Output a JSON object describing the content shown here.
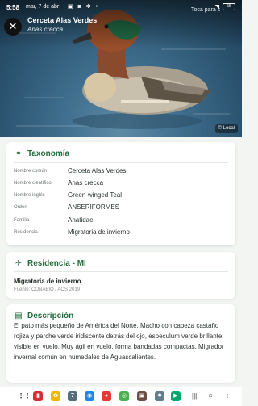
{
  "status_bar": {
    "time": "5:58",
    "date": "mar, 7 de abr",
    "icons": [
      "photo-icon",
      "camera-icon",
      "settings-icon",
      "dot-icon"
    ],
    "battery": "55"
  },
  "header": {
    "title": "Cerceta Alas Verdes",
    "subtitle": "Anas crecca",
    "tap_hint": "Toca para s",
    "photo_credit": "© Local"
  },
  "taxonomy": {
    "title": "Taxonomía",
    "rows": [
      {
        "label": "Nombre común",
        "value": "Cerceta Alas Verdes"
      },
      {
        "label": "Nombre científico",
        "value": "Anas crecca"
      },
      {
        "label": "Nombre inglés",
        "value": "Green-winged Teal"
      },
      {
        "label": "Orden",
        "value": "ANSERIFORMES"
      },
      {
        "label": "Familia",
        "value": "Anatidae"
      },
      {
        "label": "Residencia",
        "value": "Migratoria de invierno"
      }
    ]
  },
  "residence": {
    "title": "Residencia - MI",
    "value": "Migratoria de invierno",
    "source": "Fuente: CONABIO / AOS 2019"
  },
  "description": {
    "title": "Descripción",
    "text": "El pato más pequeño de América del Norte. Macho con cabeza castaño rojiza y parche verde iridiscente detrás del ojo, especulum verde brillante visible en vuelo. Muy ágil en vuelo, forma bandadas compactas. Migrador invernal común en humedales de Aguascalientes."
  },
  "nav_bar": {
    "apps": [
      {
        "name": "apps-grid-icon",
        "glyph": "⋮⋮",
        "color": "#ffffff"
      },
      {
        "name": "app-red-icon",
        "glyph": "▮",
        "color": "#d32f2f"
      },
      {
        "name": "app-photos-icon",
        "glyph": "✿",
        "color": "#f5b400"
      },
      {
        "name": "app-calendar-icon",
        "glyph": "7",
        "color": "#546e7a"
      },
      {
        "name": "app-browser-icon",
        "glyph": "◉",
        "color": "#1e88e5"
      },
      {
        "name": "app-chat-icon",
        "glyph": "●",
        "color": "#e53935"
      },
      {
        "name": "app-chrome-icon",
        "glyph": "◎",
        "color": "#4caf50"
      },
      {
        "name": "app-photo-icon",
        "glyph": "▣",
        "color": "#6d4c41"
      },
      {
        "name": "app-settings-icon",
        "glyph": "✹",
        "color": "#607d8b"
      },
      {
        "name": "app-play-icon",
        "glyph": "▶",
        "color": "#00a86b"
      }
    ],
    "recent": "|||",
    "home": "○",
    "back": "‹"
  }
}
